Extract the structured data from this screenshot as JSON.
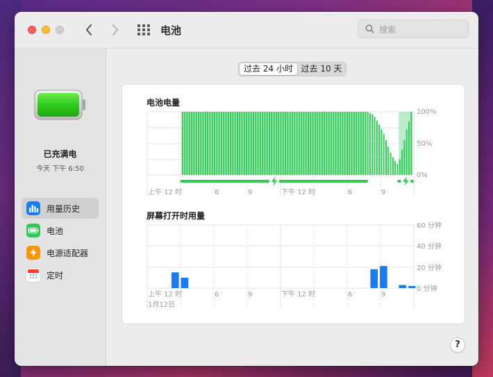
{
  "window": {
    "title": "电池"
  },
  "search": {
    "placeholder": "搜索"
  },
  "sidebar": {
    "status_title": "已充满电",
    "status_time": "今天 下午 6:50",
    "items": [
      {
        "label": "用量历史",
        "icon": "bar-chart-icon",
        "selected": true,
        "color": "#1a7cf5"
      },
      {
        "label": "电池",
        "icon": "battery-icon",
        "selected": false,
        "color": "#34c759"
      },
      {
        "label": "电源适配器",
        "icon": "bolt-icon",
        "selected": false,
        "color": "#ff9500"
      },
      {
        "label": "定时",
        "icon": "calendar-icon",
        "selected": false,
        "color": "#ffffff"
      }
    ]
  },
  "range_tabs": [
    {
      "label": "过去 24 小时",
      "active": true
    },
    {
      "label": "过去 10 天",
      "active": false
    }
  ],
  "help": {
    "label": "?"
  },
  "chart_data": [
    {
      "type": "bar",
      "title": "电池电量",
      "y_ticks": [
        "100%",
        "50%",
        "0%"
      ],
      "ylim": [
        0,
        100
      ],
      "x_ticks": [
        "上午 12 时",
        "6",
        "9",
        "下午 12 时",
        "6",
        "9"
      ],
      "colors": {
        "bar": "#2ecc55",
        "fill": "#bdeccb",
        "charging": "#2ecc55"
      },
      "values": [
        0,
        0,
        0,
        0,
        0,
        0,
        0,
        0,
        0,
        0,
        0,
        0,
        0,
        0,
        0,
        100,
        100,
        100,
        100,
        100,
        100,
        100,
        100,
        100,
        100,
        100,
        100,
        100,
        100,
        100,
        100,
        100,
        100,
        100,
        100,
        100,
        100,
        100,
        100,
        100,
        100,
        100,
        100,
        100,
        100,
        100,
        100,
        100,
        100,
        100,
        100,
        100,
        100,
        100,
        100,
        100,
        100,
        100,
        100,
        100,
        100,
        100,
        100,
        100,
        100,
        100,
        100,
        100,
        100,
        100,
        100,
        100,
        100,
        100,
        100,
        100,
        100,
        100,
        100,
        100,
        100,
        100,
        100,
        100,
        100,
        100,
        100,
        100,
        100,
        100,
        100,
        100,
        100,
        100,
        100,
        100,
        100,
        98,
        96,
        92,
        86,
        80,
        72,
        65,
        55,
        45,
        35,
        28,
        22,
        18,
        25,
        40,
        55,
        72,
        85,
        100
      ],
      "charging": [
        0,
        0,
        0,
        0,
        0,
        0,
        0,
        0,
        0,
        0,
        0,
        0,
        0,
        0,
        0,
        1,
        1,
        1,
        1,
        1,
        1,
        1,
        1,
        1,
        1,
        1,
        1,
        1,
        1,
        1,
        1,
        1,
        1,
        1,
        1,
        1,
        1,
        1,
        1,
        1,
        1,
        1,
        1,
        1,
        1,
        1,
        1,
        1,
        1,
        1,
        1,
        1,
        1,
        1,
        1,
        1,
        1,
        1,
        1,
        1,
        1,
        1,
        1,
        1,
        1,
        1,
        1,
        1,
        1,
        1,
        1,
        1,
        1,
        1,
        1,
        1,
        1,
        1,
        1,
        1,
        1,
        1,
        1,
        1,
        1,
        1,
        1,
        1,
        1,
        1,
        1,
        1,
        1,
        1,
        1,
        1,
        0,
        0,
        0,
        0,
        0,
        0,
        0,
        0,
        0,
        0,
        0,
        0,
        0,
        0,
        1,
        1,
        1,
        1,
        1,
        1
      ]
    },
    {
      "type": "bar",
      "title": "屏幕打开时用量",
      "y_ticks": [
        "60 分钟",
        "40 分钟",
        "20 分钟",
        "0 分钟"
      ],
      "ylim": [
        0,
        60
      ],
      "x_ticks": [
        "上午 12 时",
        "6",
        "9",
        "下午 12 时",
        "6",
        "9"
      ],
      "date_label": "1月12日",
      "colors": {
        "bar": "#1a7cf5"
      },
      "values": [
        0,
        0,
        0,
        15,
        10,
        0,
        0,
        0,
        0,
        0,
        0,
        0,
        0,
        0,
        0,
        0,
        0,
        0,
        0,
        0,
        0,
        0,
        0,
        0,
        18,
        21,
        0,
        3,
        2,
        0
      ]
    }
  ]
}
